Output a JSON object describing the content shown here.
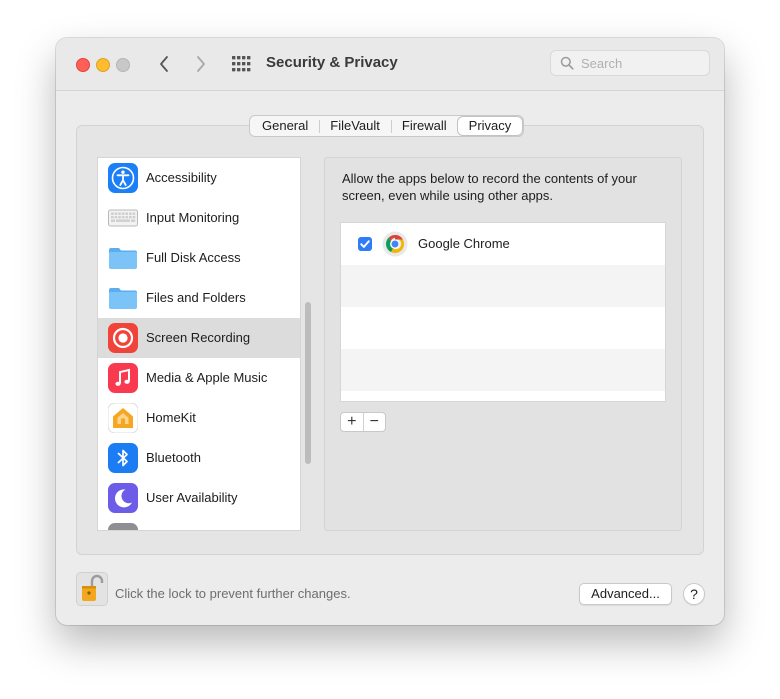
{
  "window": {
    "title": "Security & Privacy",
    "search_placeholder": "Search"
  },
  "tabs": [
    {
      "label": "General",
      "active": false
    },
    {
      "label": "FileVault",
      "active": false
    },
    {
      "label": "Firewall",
      "active": false
    },
    {
      "label": "Privacy",
      "active": true
    }
  ],
  "sidebar": {
    "selected": "Screen Recording",
    "items": [
      {
        "label": "Accessibility",
        "icon": "accessibility-icon"
      },
      {
        "label": "Input Monitoring",
        "icon": "keyboard-icon"
      },
      {
        "label": "Full Disk Access",
        "icon": "folder-icon"
      },
      {
        "label": "Files and Folders",
        "icon": "folder-icon"
      },
      {
        "label": "Screen Recording",
        "icon": "screen-recording-icon"
      },
      {
        "label": "Media & Apple Music",
        "icon": "music-note-icon"
      },
      {
        "label": "HomeKit",
        "icon": "home-icon"
      },
      {
        "label": "Bluetooth",
        "icon": "bluetooth-icon"
      },
      {
        "label": "User Availability",
        "icon": "moon-icon"
      }
    ]
  },
  "detail": {
    "description": "Allow the apps below to record the contents of your screen, even while using other apps.",
    "apps": [
      {
        "name": "Google Chrome",
        "checked": true,
        "icon": "chrome-icon"
      }
    ],
    "add_label": "+",
    "remove_label": "−"
  },
  "footer": {
    "lock_text": "Click the lock to prevent further changes.",
    "advanced_label": "Advanced...",
    "help_label": "?"
  },
  "colors": {
    "accent": "#2f7cf6",
    "close": "#ff5f57",
    "minimize": "#febc2e",
    "zoom_disabled": "#c8c8c8"
  }
}
